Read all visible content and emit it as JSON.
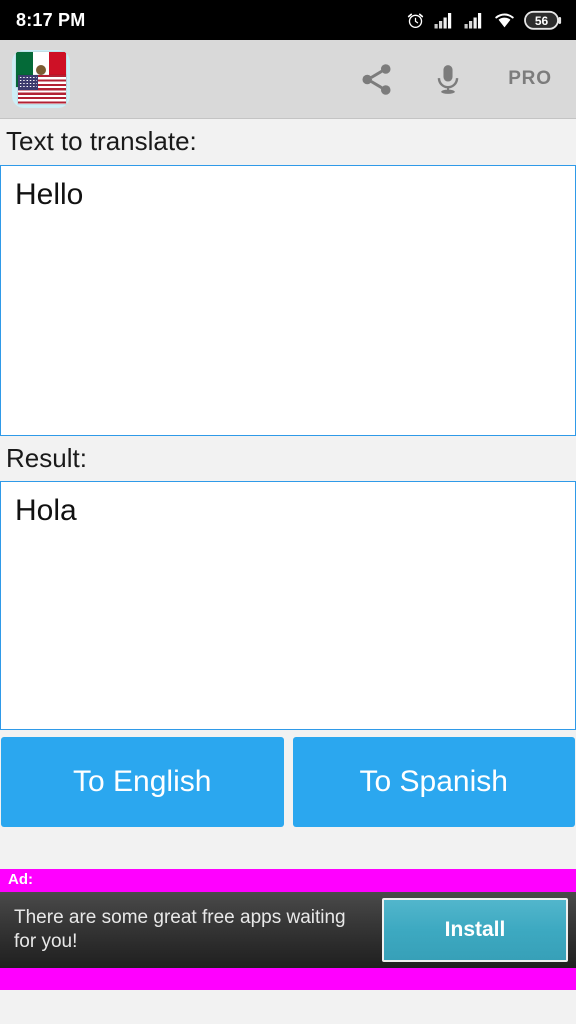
{
  "status_bar": {
    "time": "8:17 PM",
    "battery_level": "56",
    "icons": [
      "alarm-clock-icon",
      "signal-bars-icon",
      "signal-bars-icon",
      "wifi-icon",
      "battery-icon"
    ]
  },
  "toolbar": {
    "app_icon_name": "mexico-usa-flags-app-icon",
    "share_label": "share-icon",
    "mic_label": "microphone-icon",
    "pro_label": "PRO"
  },
  "main": {
    "input_label": "Text to translate:",
    "input_value": "Hello",
    "input_placeholder": "",
    "result_label": "Result:",
    "result_value": "Hola",
    "buttons": [
      {
        "label": "To English",
        "name": "to-english-button"
      },
      {
        "label": "To Spanish",
        "name": "to-spanish-button"
      }
    ]
  },
  "ad": {
    "label": "Ad:",
    "text": "There are some great free apps waiting for you!",
    "install_label": "Install"
  },
  "colors": {
    "accent_blue": "#2ba7ef",
    "field_border": "#2f9ae8",
    "toolbar_bg": "#d9d9d9",
    "page_bg": "#f2f2f2",
    "ad_magenta": "#ff00ff",
    "install_teal": "#3da9c1",
    "status_bg": "#000000"
  }
}
